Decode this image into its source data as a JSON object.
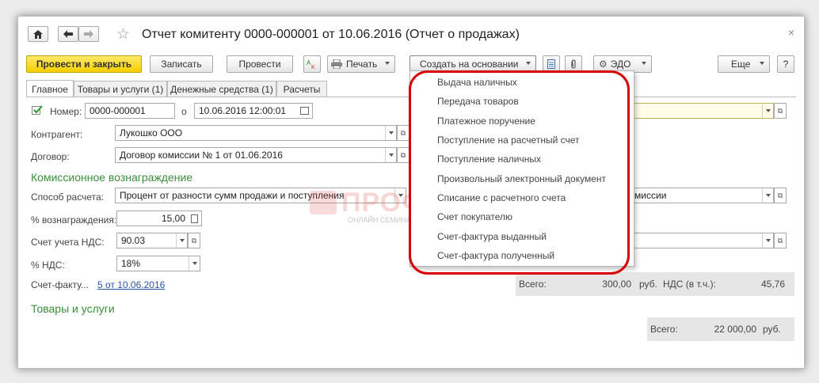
{
  "window": {
    "title": "Отчет комитенту 0000-000001 от 10.06.2016 (Отчет о продажах)",
    "close": "×"
  },
  "toolbar": {
    "post_and_close": "Провести и закрыть",
    "save": "Записать",
    "post": "Провести",
    "print": "Печать",
    "create_based_on": "Создать на основании",
    "edo": "ЭДО",
    "more": "Еще",
    "help": "?"
  },
  "tabs": [
    {
      "label": "Главное"
    },
    {
      "label": "Товары и услуги (1)"
    },
    {
      "label": "Денежные средства (1)"
    },
    {
      "label": "Расчеты"
    }
  ],
  "form": {
    "number_label": "Номер:",
    "number_value": "0000-000001",
    "date_label": "о",
    "date_value": "10.06.2016 12:00:01",
    "counterparty_label": "Контрагент:",
    "counterparty_value": "Лукошко ООО",
    "contract_label": "Договор:",
    "contract_value": "Договор комиссии № 1 от 01.06.2016",
    "commission_section": "Комиссионное вознаграждение",
    "calc_method_label": "Способ расчета:",
    "calc_method_value": "Процент от разности сумм продажи и поступления",
    "calc_method_right": "комиссии",
    "reward_pct_label": "% вознаграждения:",
    "reward_pct_value": "15,00",
    "vat_account_label": "Счет учета НДС:",
    "vat_account_value": "90.03",
    "vat_pct_label": "% НДС:",
    "vat_pct_value": "18%",
    "invoice_label": "Счет-факту...",
    "invoice_link": "5 от 10.06.2016",
    "goods_section": "Товары и услуги"
  },
  "totals_commission": {
    "total_label": "Всего:",
    "total_value": "300,00",
    "currency": "руб.",
    "vat_label": "НДС (в т.ч.):",
    "vat_value": "45,76"
  },
  "totals_goods": {
    "total_label": "Всего:",
    "total_value": "22 000,00",
    "currency": "руб."
  },
  "menu": {
    "items": [
      "Выдача наличных",
      "Передача товаров",
      "Платежное поручение",
      "Поступление на расчетный счет",
      "Поступление наличных",
      "Произвольный электронный документ",
      "Списание с расчетного счета",
      "Счет покупателю",
      "Счет-фактура выданный",
      "Счет-фактура полученный"
    ]
  },
  "watermark": {
    "brand": "ПРОФБУХ8.РУ",
    "tagline": "ОНЛАЙН СЕМИНАРЫ И ВИДЕОКУРСЫ 1С:8"
  },
  "colors": {
    "primary_button": "#f5cf00",
    "section_heading": "#3c8e3c",
    "link": "#2a54a6",
    "highlight": "#d80000"
  }
}
